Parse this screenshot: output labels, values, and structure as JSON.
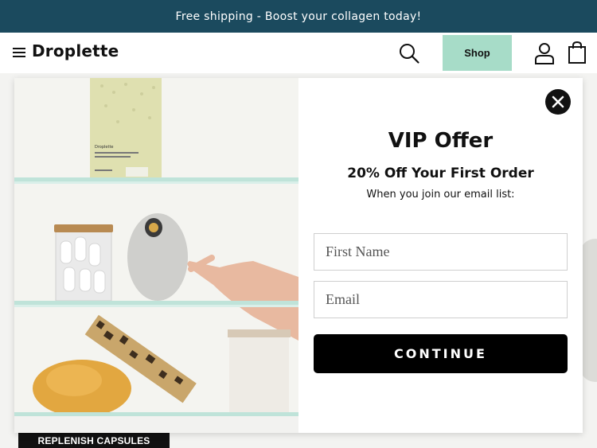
{
  "banner": {
    "text": "Free shipping - Boost your collagen today!"
  },
  "header": {
    "logo": "Droplette",
    "shop_label": "Shop",
    "icons": [
      "menu-icon",
      "search-icon",
      "account-icon",
      "cart-icon"
    ]
  },
  "page": {
    "badge": "REPLENISH CAPSULES"
  },
  "modal": {
    "title": "VIP Offer",
    "subtitle": "20% Off Your First Order",
    "description": "When you join our email list:",
    "first_name_placeholder": "First Name",
    "first_name_value": "",
    "email_placeholder": "Email",
    "email_value": "",
    "continue_label": "CONTINUE",
    "image": {
      "product_box_brand": "Droplette"
    }
  },
  "colors": {
    "banner": "#1b4a5e",
    "shop_button": "#a7dcc8",
    "cta": "#000000",
    "shelf_glass": "#bfe3d9"
  }
}
